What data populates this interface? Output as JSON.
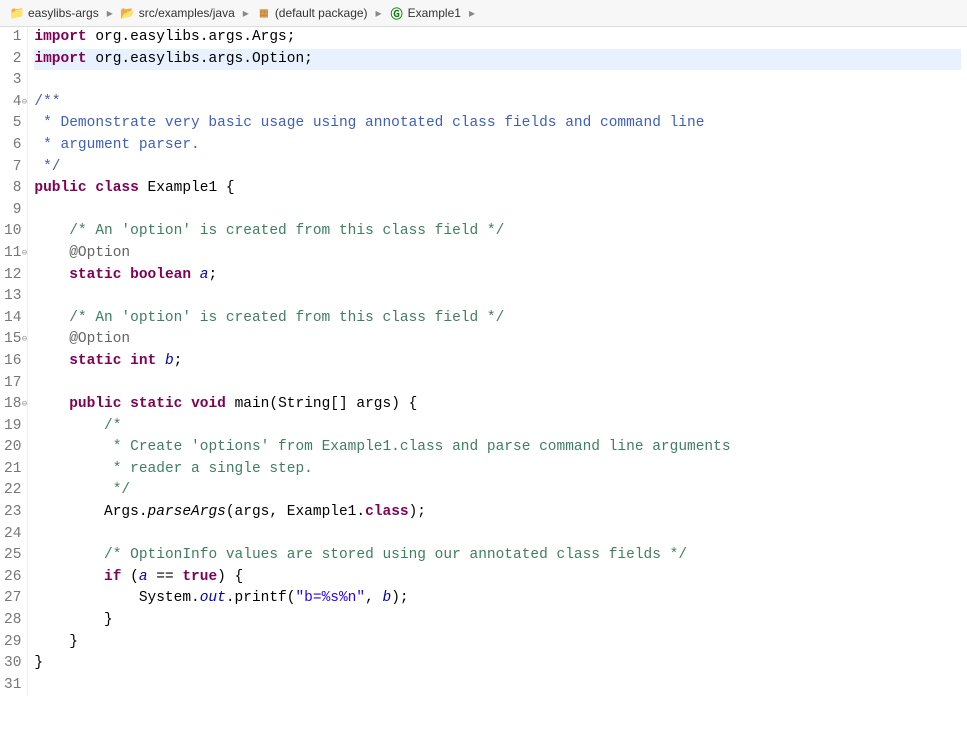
{
  "breadcrumb": [
    {
      "icon": "project",
      "label": "easylibs-args"
    },
    {
      "icon": "folder",
      "label": "src/examples/java"
    },
    {
      "icon": "package",
      "label": "(default package)"
    },
    {
      "icon": "class",
      "label": "Example1"
    }
  ],
  "lines": [
    {
      "n": 1,
      "fold": "",
      "html": "<span class='kw'>import</span> org.easylibs.args.Args;"
    },
    {
      "n": 2,
      "fold": "",
      "active": true,
      "html": "<span class='kw'>import</span> org.easylibs.args.Option;"
    },
    {
      "n": 3,
      "fold": "",
      "html": ""
    },
    {
      "n": 4,
      "fold": "⊖",
      "html": "<span class='jdoc'>/**</span>"
    },
    {
      "n": 5,
      "fold": "",
      "html": "<span class='jdoc'> * Demonstrate very basic usage using annotated class fields and command line</span>"
    },
    {
      "n": 6,
      "fold": "",
      "html": "<span class='jdoc'> * argument parser.</span>"
    },
    {
      "n": 7,
      "fold": "",
      "html": "<span class='jdoc'> */</span>"
    },
    {
      "n": 8,
      "fold": "",
      "html": "<span class='kw'>public</span> <span class='kw'>class</span> Example1 {"
    },
    {
      "n": 9,
      "fold": "",
      "html": ""
    },
    {
      "n": 10,
      "fold": "",
      "html": "    <span class='comment'>/* An 'option' is created from this class field */</span>"
    },
    {
      "n": 11,
      "fold": "⊖",
      "html": "    <span class='annot'>@Option</span>"
    },
    {
      "n": 12,
      "fold": "",
      "html": "    <span class='kw'>static</span> <span class='kw'>boolean</span> <span class='field'>a</span>;"
    },
    {
      "n": 13,
      "fold": "",
      "html": ""
    },
    {
      "n": 14,
      "fold": "",
      "html": "    <span class='comment'>/* An 'option' is created from this class field */</span>"
    },
    {
      "n": 15,
      "fold": "⊖",
      "html": "    <span class='annot'>@Option</span>"
    },
    {
      "n": 16,
      "fold": "",
      "html": "    <span class='kw'>static</span> <span class='kw'>int</span> <span class='field'>b</span>;"
    },
    {
      "n": 17,
      "fold": "",
      "html": ""
    },
    {
      "n": 18,
      "fold": "⊖",
      "html": "    <span class='kw'>public</span> <span class='kw'>static</span> <span class='kw'>void</span> main(String[] args) {"
    },
    {
      "n": 19,
      "fold": "",
      "html": "        <span class='comment'>/*</span>"
    },
    {
      "n": 20,
      "fold": "",
      "html": "        <span class='comment'> * Create 'options' from Example1.class and parse command line arguments</span>"
    },
    {
      "n": 21,
      "fold": "",
      "html": "        <span class='comment'> * reader a single step.</span>"
    },
    {
      "n": 22,
      "fold": "",
      "html": "        <span class='comment'> */</span>"
    },
    {
      "n": 23,
      "fold": "",
      "html": "        Args.<span class='staticm'>parseArgs</span>(args, Example1.<span class='kw'>class</span>);"
    },
    {
      "n": 24,
      "fold": "",
      "html": ""
    },
    {
      "n": 25,
      "fold": "",
      "html": "        <span class='comment'>/* OptionInfo values are stored using our annotated class fields */</span>"
    },
    {
      "n": 26,
      "fold": "",
      "html": "        <span class='kw'>if</span> (<span class='field'>a</span> == <span class='kw'>true</span>) {"
    },
    {
      "n": 27,
      "fold": "",
      "html": "            System.<span class='field'>out</span>.printf(<span class='str'>\"b=%s%n\"</span>, <span class='field'>b</span>);"
    },
    {
      "n": 28,
      "fold": "",
      "html": "        }"
    },
    {
      "n": 29,
      "fold": "",
      "html": "    }"
    },
    {
      "n": 30,
      "fold": "",
      "html": "}"
    },
    {
      "n": 31,
      "fold": "",
      "html": ""
    }
  ]
}
